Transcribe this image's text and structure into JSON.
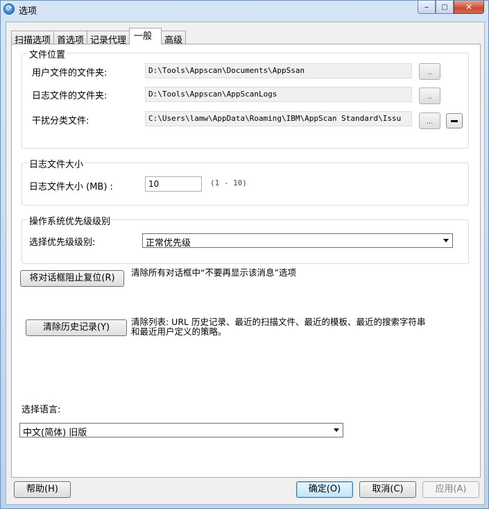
{
  "window": {
    "title": "选项"
  },
  "tabs": [
    "扫描选项",
    "首选项",
    "记录代理",
    "一般",
    "高级"
  ],
  "file_locations": {
    "group_title": "文件位置",
    "rows": [
      {
        "label": "用户文件的文件夹:",
        "value": "D:\\Tools\\Appscan\\Documents\\AppSsan",
        "browse_label": ".."
      },
      {
        "label": "日志文件的文件夹:",
        "value": "D:\\Tools\\Appscan\\AppScanLogs",
        "browse_label": ".."
      },
      {
        "label": "干扰分类文件:",
        "value": "C:\\Users\\lamw\\AppData\\Roaming\\IBM\\AppScan Standard\\Issu",
        "browse_label": "..."
      }
    ]
  },
  "log_size": {
    "group_title": "日志文件大小",
    "label": "日志文件大小 (MB) :",
    "value": "10",
    "range_hint": "(1 - 10)"
  },
  "priority": {
    "group_title": "操作系统优先级级别",
    "label": "选择优先级级别:",
    "selected": "正常优先级"
  },
  "reset_dialogs": {
    "button_label": "将对话框阻止复位(R)",
    "description": "清除所有对话框中“不要再显示该消息”选项"
  },
  "clear_history": {
    "button_label": "清除历史记录(Y)",
    "description_line1": "清除列表: URL 历史记录、最近的扫描文件、最近的模板、最近的搜索字符串",
    "description_line2": "和最近用户定义的策略。"
  },
  "language": {
    "label": "选择语言:",
    "selected": "中文(简体) 旧版"
  },
  "footer": {
    "help_label": "帮助(H)",
    "ok_label": "确定(O)",
    "cancel_label": "取消(C)",
    "apply_label": "应用(A)"
  }
}
